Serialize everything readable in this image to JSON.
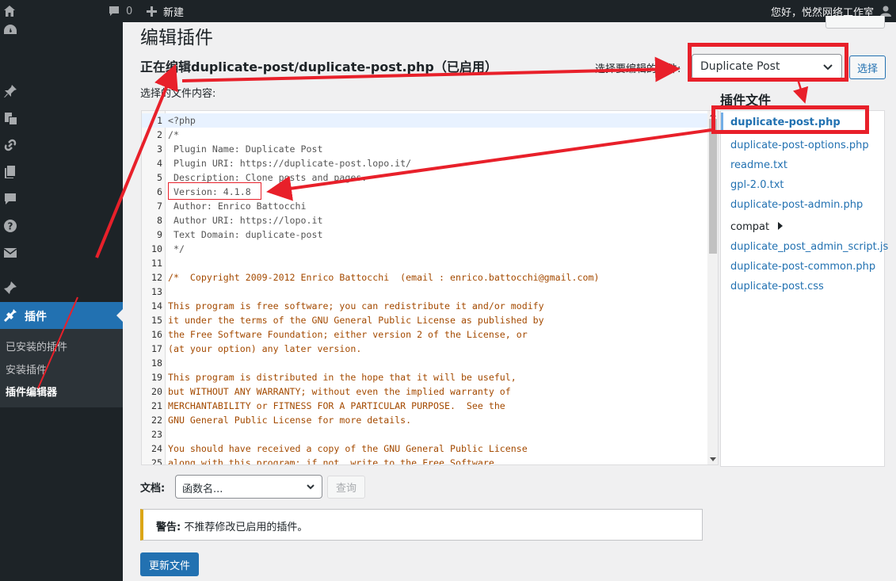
{
  "adminbar": {
    "comments_count": "0",
    "new_label": "新建",
    "greeting": "您好，悦然网络工作室"
  },
  "sidebar": {
    "plugins_label": "插件",
    "submenu": [
      {
        "label": "已安装的插件"
      },
      {
        "label": "安装插件"
      },
      {
        "label": "插件编辑器"
      }
    ]
  },
  "main": {
    "page_title": "编辑插件",
    "editing_title": "正在编辑duplicate-post/duplicate-post.php（已启用）",
    "select_plugin_label": "选择要编辑的插件:",
    "selected_plugin": "Duplicate Post",
    "choose_button": "选择",
    "content_label": "选择的文件内容:",
    "plugin_files_title": "插件文件"
  },
  "code_lines": [
    {
      "num": "1",
      "text": "<?php"
    },
    {
      "num": "2",
      "text": "/*"
    },
    {
      "num": "3",
      "text": " Plugin Name: Duplicate Post"
    },
    {
      "num": "4",
      "text": " Plugin URI: https://duplicate-post.lopo.it/"
    },
    {
      "num": "5",
      "text": " Description: Clone posts and pages."
    },
    {
      "num": "6",
      "text": " Version: 4.1.8"
    },
    {
      "num": "7",
      "text": " Author: Enrico Battocchi"
    },
    {
      "num": "8",
      "text": " Author URI: https://lopo.it"
    },
    {
      "num": "9",
      "text": " Text Domain: duplicate-post"
    },
    {
      "num": "10",
      "text": " */"
    },
    {
      "num": "11",
      "text": ""
    },
    {
      "num": "12",
      "text": "/*  Copyright 2009-2012 Enrico Battocchi  (email : enrico.battocchi@gmail.com)"
    },
    {
      "num": "13",
      "text": ""
    },
    {
      "num": "14",
      "text": "This program is free software; you can redistribute it and/or modify"
    },
    {
      "num": "15",
      "text": "it under the terms of the GNU General Public License as published by"
    },
    {
      "num": "16",
      "text": "the Free Software Foundation; either version 2 of the License, or"
    },
    {
      "num": "17",
      "text": "(at your option) any later version."
    },
    {
      "num": "18",
      "text": ""
    },
    {
      "num": "19",
      "text": "This program is distributed in the hope that it will be useful,"
    },
    {
      "num": "20",
      "text": "but WITHOUT ANY WARRANTY; without even the implied warranty of"
    },
    {
      "num": "21",
      "text": "MERCHANTABILITY or FITNESS FOR A PARTICULAR PURPOSE.  See the"
    },
    {
      "num": "22",
      "text": "GNU General Public License for more details."
    },
    {
      "num": "23",
      "text": ""
    },
    {
      "num": "24",
      "text": "You should have received a copy of the GNU General Public License"
    },
    {
      "num": "25",
      "text": "along with this program; if not, write to the Free Software"
    }
  ],
  "files": [
    {
      "name": "duplicate-post.php"
    },
    {
      "name": "duplicate-post-options.php"
    },
    {
      "name": "readme.txt"
    },
    {
      "name": "gpl-2.0.txt"
    },
    {
      "name": "duplicate-post-admin.php"
    },
    {
      "name": "compat"
    },
    {
      "name": "duplicate_post_admin_script.js"
    },
    {
      "name": "duplicate-post-common.php"
    },
    {
      "name": "duplicate-post.css"
    }
  ],
  "bottom": {
    "doc_label": "文档:",
    "doc_select_value": "函数名...",
    "lookup_button": "查询",
    "warning_strong": "警告:",
    "warning_text": "不推荐修改已启用的插件。",
    "update_button": "更新文件"
  },
  "colors": {
    "admin_dark": "#1d2327",
    "wp_blue": "#2271b1",
    "annotation_red": "#e8202a",
    "warning_yellow": "#dba617"
  }
}
